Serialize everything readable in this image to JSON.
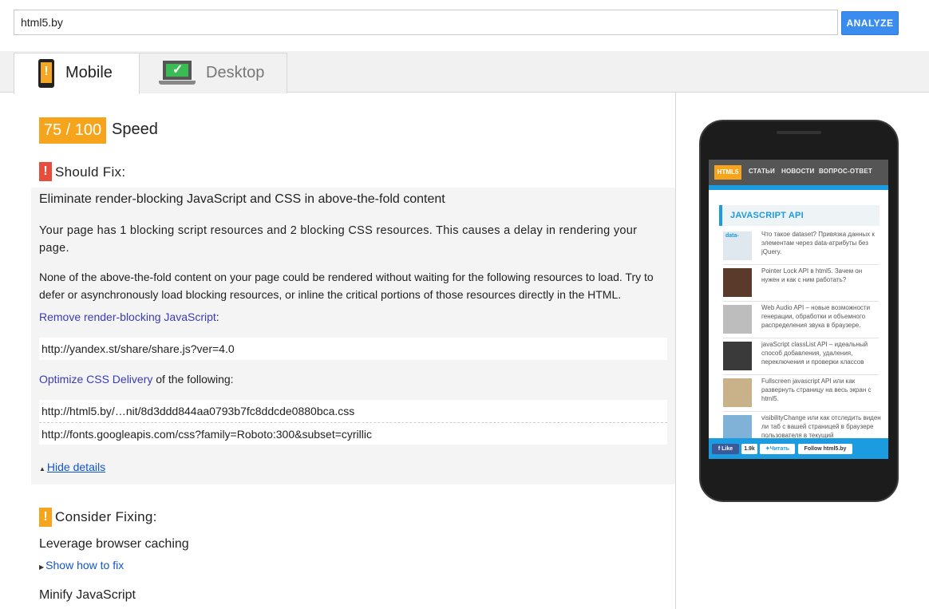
{
  "search": {
    "value": "html5.by",
    "analyze_label": "ANALYZE"
  },
  "tabs": {
    "mobile": "Mobile",
    "desktop": "Desktop"
  },
  "score": {
    "value": "75 / 100",
    "label": "Speed"
  },
  "should_fix": {
    "title": "Should Fix:",
    "rule_title": "Eliminate render-blocking JavaScript and CSS in above-the-fold content",
    "summary": "Your page has 1 blocking script resources and 2 blocking CSS resources. This causes a delay in rendering your page.",
    "details": "None of the above-the-fold content on your page could be rendered without waiting for the following resources to load. Try to defer or asynchronously load blocking resources, or inline the critical portions of those resources directly in the HTML.",
    "js_link": "Remove render-blocking JavaScript",
    "js_suffix": ":",
    "js_resources": [
      "http://yandex.st/share/share.js?ver=4.0"
    ],
    "css_link": "Optimize CSS Delivery",
    "css_suffix": " of the following:",
    "css_resources": [
      "http://html5.by/…nit/8d3ddd844aa0793b7fc8ddcde0880bca.css",
      "http://fonts.googleapis.com/css?family=Roboto:300&subset=cyrillic"
    ],
    "hide_details": "Hide details"
  },
  "consider_fixing": {
    "title": "Consider Fixing:",
    "rules": [
      {
        "title": "Leverage browser caching",
        "toggle": "Show how to fix"
      },
      {
        "title": "Minify JavaScript"
      }
    ]
  },
  "preview": {
    "nav": {
      "logo": "HTML5",
      "items": [
        "СТАТЬИ",
        "НОВОСТИ",
        "ВОПРОС-ОТВЕТ"
      ]
    },
    "section_title": "JAVASCRIPT API",
    "articles": [
      {
        "text": "Что такое dataset? Привязка данных к элементам через data-атрибуты без jQuery.",
        "thumb_color": "#dfe8ee",
        "thumb_text": "data-"
      },
      {
        "text": "Pointer Lock API в html5. Зачем он нужен и как с ним работать?",
        "thumb_color": "#5a3a2a",
        "thumb_text": ""
      },
      {
        "text": "Web Audio API – новые возможности генерации, обработки и объемного распределения звука в браузере.",
        "thumb_color": "#bdbdbd",
        "thumb_text": ""
      },
      {
        "text": "javaScript classList API – идеальный способ добавления, удаления, переключения и проверки классов",
        "thumb_color": "#3a3a3a",
        "thumb_text": ""
      },
      {
        "text": "Fullscreen javascript API или как развернуть страницу на весь экран с html5.",
        "thumb_color": "#c9b28a",
        "thumb_text": ""
      },
      {
        "text": "visibilityChange или как отследить виден ли таб с вашей страницей в браузере пользователя в текущий",
        "thumb_color": "#7fb2d6",
        "thumb_text": ""
      }
    ],
    "social": {
      "like": "Like",
      "like_count": "1.9k",
      "read": "Читать",
      "follow": "Follow html5.by"
    }
  }
}
